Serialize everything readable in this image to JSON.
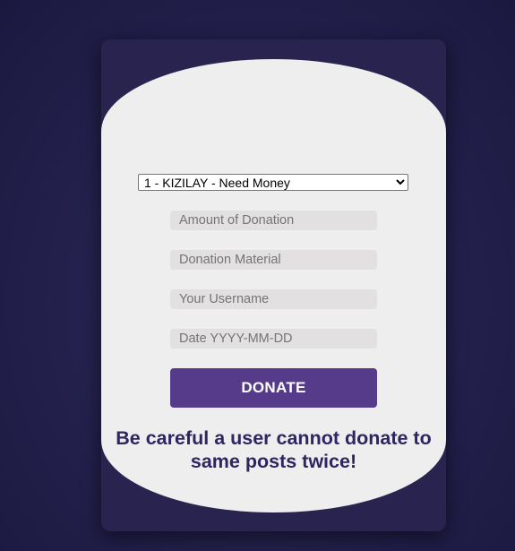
{
  "form": {
    "post_select": {
      "selected": "1 - KIZILAY - Need Money",
      "options": [
        "1 - KIZILAY - Need Money"
      ]
    },
    "amount_placeholder": "Amount of Donation",
    "material_placeholder": "Donation Material",
    "username_placeholder": "Your Username",
    "date_placeholder": "Date YYYY-MM-DD",
    "donate_label": "DONATE",
    "warning_text": "Be careful a user cannot donate to same posts twice!"
  },
  "colors": {
    "page_background": "#25224f",
    "card_background": "#28234f",
    "form_background": "#eeeeee",
    "input_background": "#e2e0e1",
    "button_background": "#563b8b",
    "warning_text": "#2d2660"
  }
}
